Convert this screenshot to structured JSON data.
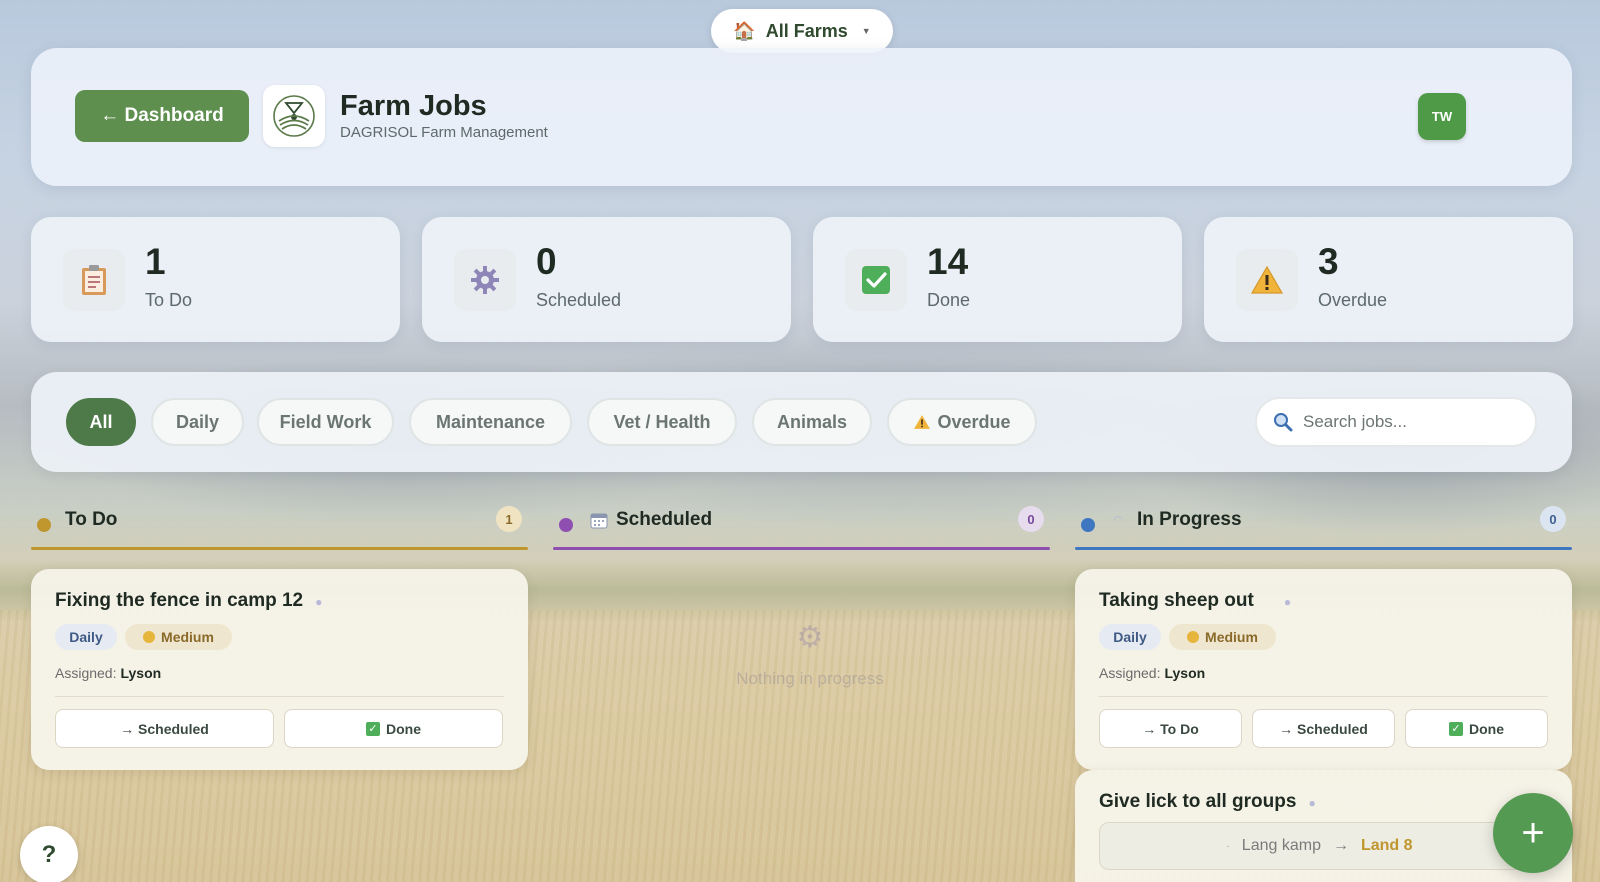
{
  "farm_selector": {
    "label": "All Farms",
    "house_icon": "house-icon"
  },
  "header": {
    "back_label": "← Dashboard",
    "title": "Farm Jobs",
    "subtitle": "DAGRISOL Farm Management",
    "avatar_initials": "TW"
  },
  "stats": [
    {
      "value": "1",
      "label": "To Do",
      "icon": "clipboard-icon"
    },
    {
      "value": "0",
      "label": "Scheduled",
      "icon": "gear-icon"
    },
    {
      "value": "14",
      "label": "Done",
      "icon": "check-icon"
    },
    {
      "value": "3",
      "label": "Overdue",
      "icon": "warning-icon"
    }
  ],
  "filters": {
    "chips": [
      "All",
      "Daily",
      "Field Work",
      "Maintenance",
      "Vet / Health",
      "Animals",
      "Overdue"
    ],
    "active": "All",
    "search_placeholder": "Search jobs..."
  },
  "columns": {
    "todo": {
      "title": "To Do",
      "count": "1",
      "color": "#c0962e"
    },
    "scheduled": {
      "title": "Scheduled",
      "count": "0",
      "color": "#8e4fb0",
      "empty_text": "Nothing in progress"
    },
    "in_progress": {
      "title": "In Progress",
      "count": "0",
      "color": "#3f77c0"
    }
  },
  "jobs": {
    "todo_1": {
      "title": "Fixing the fence in camp 12",
      "tags": [
        "Daily",
        "Medium"
      ],
      "assigned_label": "Assigned:",
      "assignee": "Lyson",
      "actions": [
        "→ Scheduled",
        "Done"
      ]
    },
    "progress_1": {
      "title": "Taking sheep out",
      "tags": [
        "Daily",
        "Medium"
      ],
      "assigned_label": "Assigned:",
      "assignee": "Lyson",
      "actions": [
        "→ To Do",
        "→ Scheduled",
        "Done"
      ]
    },
    "progress_2": {
      "title": "Give lick to all groups",
      "route_from": "Lang kamp",
      "route_arrow": "→",
      "route_to": "Land 8"
    }
  },
  "fab_label": "+",
  "help_label": "?"
}
